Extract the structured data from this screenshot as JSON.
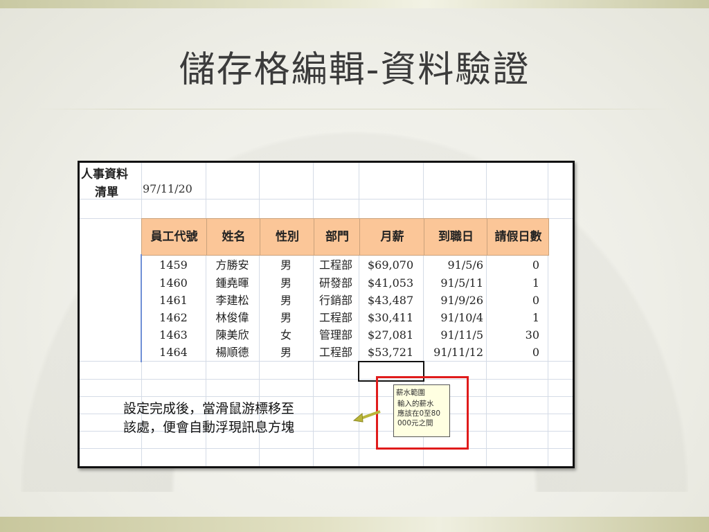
{
  "slide": {
    "title": "儲存格編輯-資料驗證"
  },
  "sheet": {
    "title_line1": "人事資料",
    "title_line2": "清單",
    "date": "97/11/20",
    "headers": [
      "員工代號",
      "姓名",
      "性別",
      "部門",
      "月薪",
      "到職日",
      "請假日數"
    ],
    "rows": [
      [
        "1459",
        "方勝安",
        "男",
        "工程部",
        "$69,070",
        "91/5/6",
        "0"
      ],
      [
        "1460",
        "鍾堯暉",
        "男",
        "研發部",
        "$41,053",
        "91/5/11",
        "1"
      ],
      [
        "1461",
        "李建松",
        "男",
        "行銷部",
        "$43,487",
        "91/9/26",
        "0"
      ],
      [
        "1462",
        "林俊偉",
        "男",
        "工程部",
        "$30,411",
        "91/10/4",
        "1"
      ],
      [
        "1463",
        "陳美欣",
        "女",
        "管理部",
        "$27,081",
        "91/11/5",
        "30"
      ],
      [
        "1464",
        "楊順德",
        "男",
        "工程部",
        "$53,721",
        "91/11/12",
        "0"
      ]
    ]
  },
  "tooltip": {
    "title": "薪水範圍",
    "line1": "輸入的薪水",
    "line2": "應該在0至80",
    "line3": "000元之間"
  },
  "note": {
    "line1": "設定完成後，當滑鼠游標移至",
    "line2": "該處，便會自動浮現訊息方塊"
  },
  "colors": {
    "header_fill": "#fbc698",
    "callout_border": "#e01b1b",
    "tooltip_bg": "#ffffe1",
    "arrow": "#b9b53a"
  }
}
